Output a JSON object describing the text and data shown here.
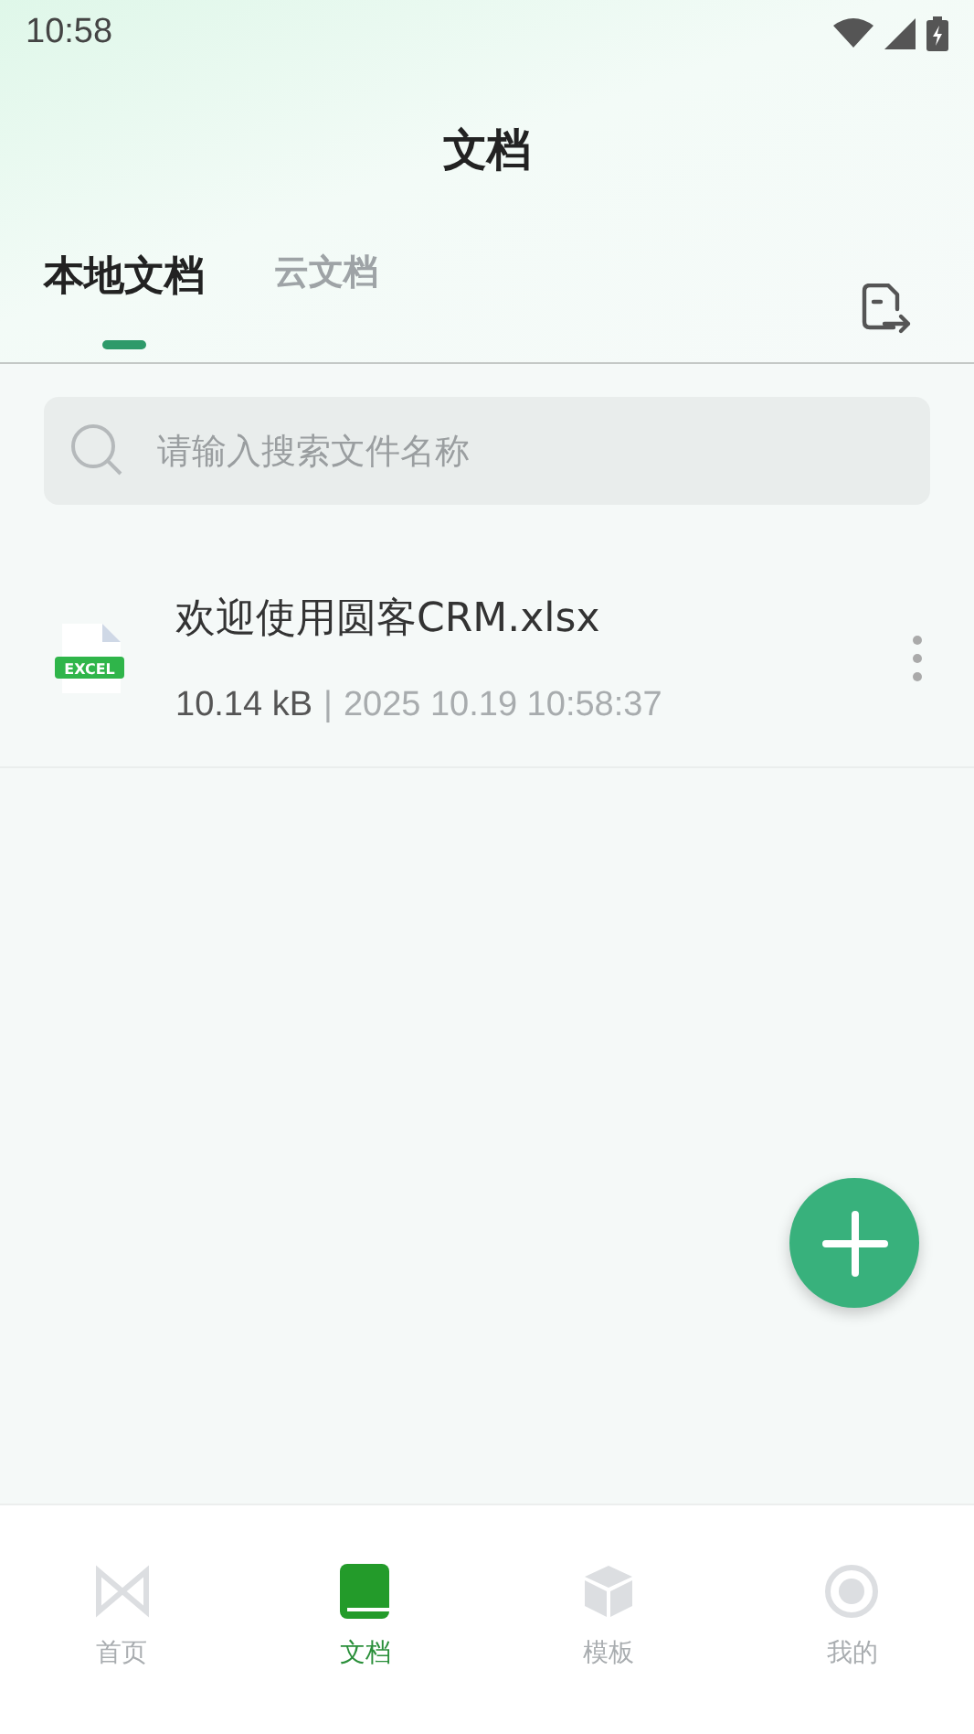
{
  "status_bar": {
    "time": "10:58"
  },
  "header": {
    "title": "文档"
  },
  "tabs": [
    {
      "label": "本地文档",
      "selected": true
    },
    {
      "label": "云文档",
      "selected": false
    }
  ],
  "search": {
    "placeholder": "请输入搜索文件名称"
  },
  "files": [
    {
      "name": "欢迎使用圆客CRM.xlsx",
      "badge": "EXCEL",
      "size": "10.14 kB",
      "separator": "|",
      "date": "2025 10.19 10:58:37"
    }
  ],
  "bottom_nav": [
    {
      "label": "首页",
      "kind": "home",
      "selected": false
    },
    {
      "label": "文档",
      "kind": "docs",
      "selected": true
    },
    {
      "label": "模板",
      "kind": "template",
      "selected": false
    },
    {
      "label": "我的",
      "kind": "profile",
      "selected": false
    }
  ]
}
